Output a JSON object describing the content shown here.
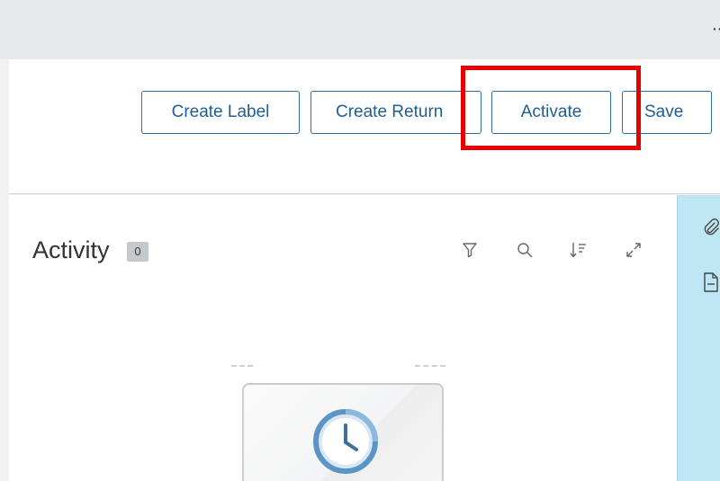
{
  "topbar": {
    "more_glyph": "··"
  },
  "toolbar": {
    "create_label": "Create Label",
    "create_return": "Create Return",
    "activate": "Activate",
    "save": "Save"
  },
  "activity": {
    "title": "Activity",
    "count": "0",
    "tools": [
      "filter-icon",
      "search-icon",
      "sort-icon",
      "expand-icon"
    ]
  },
  "empty_state": {
    "icon": "clock-icon"
  },
  "sidebar": {
    "icons": [
      "paperclip-icon",
      "document-icon"
    ]
  },
  "colors": {
    "accent": "#1f5e95",
    "highlight": "#e60000",
    "sidebar_bg": "#bfe6f5",
    "clock_blue": "#5b94c6"
  }
}
